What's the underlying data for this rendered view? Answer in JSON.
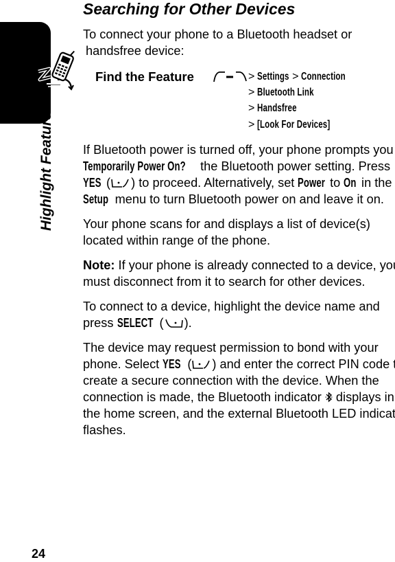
{
  "side": {
    "label": "Highlight Features",
    "tab_icon": "phone-zoom-icon"
  },
  "page_number": "24",
  "title": "Searching for Other Devices",
  "intro": {
    "line1": "To connect your phone to a Bluetooth headset or",
    "line2": "handsfree device:"
  },
  "find_the_feature": {
    "label": "Find the Feature",
    "key_icon": "menu-key-icon",
    "separator": ">",
    "path": [
      "Settings",
      "Connection",
      "Bluetooth Link",
      "Handsfree",
      "[Look For Devices]"
    ]
  },
  "para1": {
    "l1": "If Bluetooth power is turned off, your phone prompts you to",
    "prompt": "Temporarily Power On?",
    "l2_rest": " the Bluetooth power setting. Press",
    "yes": "YES",
    "l3_rest": ") to proceed. Alternatively, set ",
    "power": "Power",
    "to": " to ",
    "on": "On",
    "in_the": " in the",
    "setup": "Setup",
    "l4_rest": " menu to turn Bluetooth power on and leave it on."
  },
  "para2": {
    "l1": "Your phone scans for and displays a list of device(s)",
    "l2": "located within range of the phone."
  },
  "note": {
    "label": "Note:",
    "l1_rest": " If your phone is already connected to a device, you",
    "l2": "must disconnect from it to search for other devices."
  },
  "para3": {
    "l1": "To connect to a device, highlight the device name and",
    "press": "press ",
    "select": "SELECT",
    "end": ")."
  },
  "para4": {
    "l1": "The device may request permission to bond with your",
    "l2_a": "phone. Select ",
    "yes": "YES",
    "l2_b": ") and enter the correct PIN code to",
    "l3": "create a secure connection with the device. When the",
    "l4_a": "connection is made, the Bluetooth indicator ",
    "bt_glyph": "✻",
    "l4_b": " displays in",
    "l5": "the home screen, and the external Bluetooth LED indicator",
    "l6": "flashes."
  }
}
